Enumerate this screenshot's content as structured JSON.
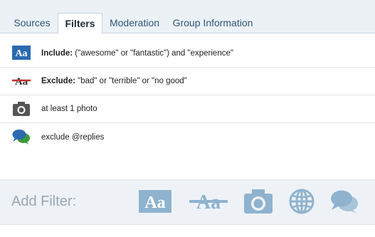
{
  "tabs": [
    {
      "label": "Sources"
    },
    {
      "label": "Filters"
    },
    {
      "label": "Moderation"
    },
    {
      "label": "Group Information"
    }
  ],
  "active_tab": "Filters",
  "filters": [
    {
      "icon": "text-icon",
      "bold": "Include:",
      "text": " (\"awesome\" or \"fantastic\") and \"experience\""
    },
    {
      "icon": "strikethrough-text-icon",
      "bold": "Exclude:",
      "text": " \"bad\" or \"terrible\" or \"no good\""
    },
    {
      "icon": "camera-icon",
      "bold": "",
      "text": "at least 1 photo"
    },
    {
      "icon": "chat-bubbles-icon",
      "bold": "",
      "text": "exclude @replies"
    }
  ],
  "add_filter": {
    "label": "Add Filter:",
    "icons": [
      "text-icon",
      "strikethrough-text-icon",
      "camera-icon",
      "globe-icon",
      "chat-bubble-icon"
    ]
  },
  "colors": {
    "accent_blue": "#2a6ab0",
    "exclude_red": "#c0302a",
    "add_icon": "#8fb3cf"
  }
}
